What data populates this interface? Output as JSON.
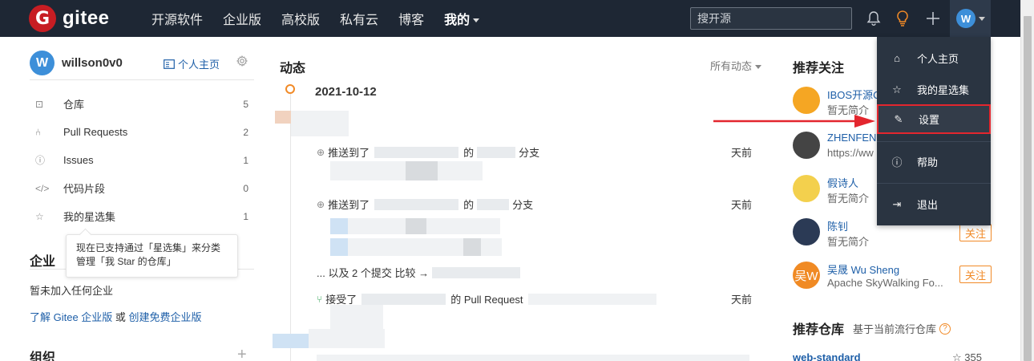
{
  "topbar": {
    "logo_text": "gitee",
    "logo_letter": "G",
    "nav": [
      "开源软件",
      "企业版",
      "高校版",
      "私有云",
      "博客"
    ],
    "nav_mine": "我的",
    "search_placeholder": "搜开源",
    "avatar_letter": "W"
  },
  "user": {
    "avatar_letter": "W",
    "username": "willson0v0",
    "home_link": "个人主页"
  },
  "sidebar": {
    "items": [
      {
        "label": "仓库",
        "count": "5",
        "icon": "repo-icon"
      },
      {
        "label": "Pull Requests",
        "count": "2",
        "icon": "pull-request-icon"
      },
      {
        "label": "Issues",
        "count": "1",
        "icon": "issue-icon"
      },
      {
        "label": "代码片段",
        "count": "0",
        "icon": "code-icon"
      },
      {
        "label": "我的星选集",
        "count": "1",
        "icon": "star-icon"
      }
    ],
    "tooltip_line1": "现在已支持通过「星选集」来分类",
    "tooltip_line2": "管理「我 Star 的仓库」",
    "enterprise_title": "企业",
    "enterprise_empty": "暂未加入任何企业",
    "enterprise_link1": "了解 Gitee 企业版",
    "enterprise_or": " 或 ",
    "enterprise_link2": "创建免费企业版",
    "org_title": "组织"
  },
  "feed": {
    "title": "动态",
    "filter": "所有动态",
    "date": "2021-10-12",
    "events": [
      {
        "prefix": "推送到了",
        "mid": "的",
        "suffix": "分支",
        "time": "天前"
      },
      {
        "prefix": "推送到了",
        "mid": "的",
        "suffix": "分支",
        "time": "天前"
      },
      {
        "prefix": "接受了",
        "mid": "的 Pull Request",
        "suffix": "",
        "time": "天前"
      }
    ],
    "more_commits": "... 以及 2 个提交 比较 →"
  },
  "recommend": {
    "title": "推荐关注",
    "follow_label": "关注",
    "users": [
      {
        "name": "IBOS开源O",
        "desc": "暂无简介",
        "color": "#f5a623"
      },
      {
        "name": "ZHENFENG",
        "desc": "https://ww",
        "color": "#444444"
      },
      {
        "name": "假诗人",
        "desc": "暂无简介",
        "color": "#f3d04d"
      },
      {
        "name": "陈钊",
        "desc": "暂无简介",
        "color": "#2b3a55"
      },
      {
        "name": "吴晟 Wu Sheng",
        "desc": "Apache SkyWalking Fo...",
        "color": "#f08a24"
      }
    ],
    "fifth_avatar_text": "吴W",
    "repo_title": "推荐仓库",
    "repo_subtitle": "基于当前流行仓库",
    "repo_name": "web-standard",
    "repo_stars": "355"
  },
  "dropdown": {
    "items": [
      {
        "label": "个人主页",
        "icon": "home-icon"
      },
      {
        "label": "我的星选集",
        "icon": "star-icon"
      },
      {
        "label": "设置",
        "icon": "edit-icon"
      },
      {
        "label": "帮助",
        "icon": "help-icon"
      },
      {
        "label": "退出",
        "icon": "logout-icon"
      }
    ]
  },
  "colors": {
    "brand": "#c71d23",
    "topbar": "#1e2734",
    "accent": "#f18a27",
    "link": "#1e5fa8",
    "highlight": "#e3262e"
  }
}
